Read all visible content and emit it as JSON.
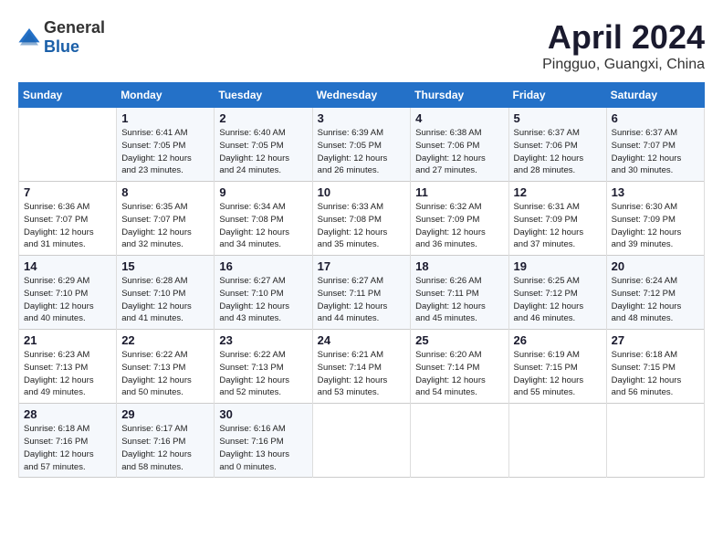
{
  "header": {
    "logo_general": "General",
    "logo_blue": "Blue",
    "month": "April 2024",
    "location": "Pingguo, Guangxi, China"
  },
  "weekdays": [
    "Sunday",
    "Monday",
    "Tuesday",
    "Wednesday",
    "Thursday",
    "Friday",
    "Saturday"
  ],
  "weeks": [
    [
      {
        "day": "",
        "info": ""
      },
      {
        "day": "1",
        "info": "Sunrise: 6:41 AM\nSunset: 7:05 PM\nDaylight: 12 hours\nand 23 minutes."
      },
      {
        "day": "2",
        "info": "Sunrise: 6:40 AM\nSunset: 7:05 PM\nDaylight: 12 hours\nand 24 minutes."
      },
      {
        "day": "3",
        "info": "Sunrise: 6:39 AM\nSunset: 7:05 PM\nDaylight: 12 hours\nand 26 minutes."
      },
      {
        "day": "4",
        "info": "Sunrise: 6:38 AM\nSunset: 7:06 PM\nDaylight: 12 hours\nand 27 minutes."
      },
      {
        "day": "5",
        "info": "Sunrise: 6:37 AM\nSunset: 7:06 PM\nDaylight: 12 hours\nand 28 minutes."
      },
      {
        "day": "6",
        "info": "Sunrise: 6:37 AM\nSunset: 7:07 PM\nDaylight: 12 hours\nand 30 minutes."
      }
    ],
    [
      {
        "day": "7",
        "info": "Sunrise: 6:36 AM\nSunset: 7:07 PM\nDaylight: 12 hours\nand 31 minutes."
      },
      {
        "day": "8",
        "info": "Sunrise: 6:35 AM\nSunset: 7:07 PM\nDaylight: 12 hours\nand 32 minutes."
      },
      {
        "day": "9",
        "info": "Sunrise: 6:34 AM\nSunset: 7:08 PM\nDaylight: 12 hours\nand 34 minutes."
      },
      {
        "day": "10",
        "info": "Sunrise: 6:33 AM\nSunset: 7:08 PM\nDaylight: 12 hours\nand 35 minutes."
      },
      {
        "day": "11",
        "info": "Sunrise: 6:32 AM\nSunset: 7:09 PM\nDaylight: 12 hours\nand 36 minutes."
      },
      {
        "day": "12",
        "info": "Sunrise: 6:31 AM\nSunset: 7:09 PM\nDaylight: 12 hours\nand 37 minutes."
      },
      {
        "day": "13",
        "info": "Sunrise: 6:30 AM\nSunset: 7:09 PM\nDaylight: 12 hours\nand 39 minutes."
      }
    ],
    [
      {
        "day": "14",
        "info": "Sunrise: 6:29 AM\nSunset: 7:10 PM\nDaylight: 12 hours\nand 40 minutes."
      },
      {
        "day": "15",
        "info": "Sunrise: 6:28 AM\nSunset: 7:10 PM\nDaylight: 12 hours\nand 41 minutes."
      },
      {
        "day": "16",
        "info": "Sunrise: 6:27 AM\nSunset: 7:10 PM\nDaylight: 12 hours\nand 43 minutes."
      },
      {
        "day": "17",
        "info": "Sunrise: 6:27 AM\nSunset: 7:11 PM\nDaylight: 12 hours\nand 44 minutes."
      },
      {
        "day": "18",
        "info": "Sunrise: 6:26 AM\nSunset: 7:11 PM\nDaylight: 12 hours\nand 45 minutes."
      },
      {
        "day": "19",
        "info": "Sunrise: 6:25 AM\nSunset: 7:12 PM\nDaylight: 12 hours\nand 46 minutes."
      },
      {
        "day": "20",
        "info": "Sunrise: 6:24 AM\nSunset: 7:12 PM\nDaylight: 12 hours\nand 48 minutes."
      }
    ],
    [
      {
        "day": "21",
        "info": "Sunrise: 6:23 AM\nSunset: 7:13 PM\nDaylight: 12 hours\nand 49 minutes."
      },
      {
        "day": "22",
        "info": "Sunrise: 6:22 AM\nSunset: 7:13 PM\nDaylight: 12 hours\nand 50 minutes."
      },
      {
        "day": "23",
        "info": "Sunrise: 6:22 AM\nSunset: 7:13 PM\nDaylight: 12 hours\nand 52 minutes."
      },
      {
        "day": "24",
        "info": "Sunrise: 6:21 AM\nSunset: 7:14 PM\nDaylight: 12 hours\nand 53 minutes."
      },
      {
        "day": "25",
        "info": "Sunrise: 6:20 AM\nSunset: 7:14 PM\nDaylight: 12 hours\nand 54 minutes."
      },
      {
        "day": "26",
        "info": "Sunrise: 6:19 AM\nSunset: 7:15 PM\nDaylight: 12 hours\nand 55 minutes."
      },
      {
        "day": "27",
        "info": "Sunrise: 6:18 AM\nSunset: 7:15 PM\nDaylight: 12 hours\nand 56 minutes."
      }
    ],
    [
      {
        "day": "28",
        "info": "Sunrise: 6:18 AM\nSunset: 7:16 PM\nDaylight: 12 hours\nand 57 minutes."
      },
      {
        "day": "29",
        "info": "Sunrise: 6:17 AM\nSunset: 7:16 PM\nDaylight: 12 hours\nand 58 minutes."
      },
      {
        "day": "30",
        "info": "Sunrise: 6:16 AM\nSunset: 7:16 PM\nDaylight: 13 hours\nand 0 minutes."
      },
      {
        "day": "",
        "info": ""
      },
      {
        "day": "",
        "info": ""
      },
      {
        "day": "",
        "info": ""
      },
      {
        "day": "",
        "info": ""
      }
    ]
  ]
}
